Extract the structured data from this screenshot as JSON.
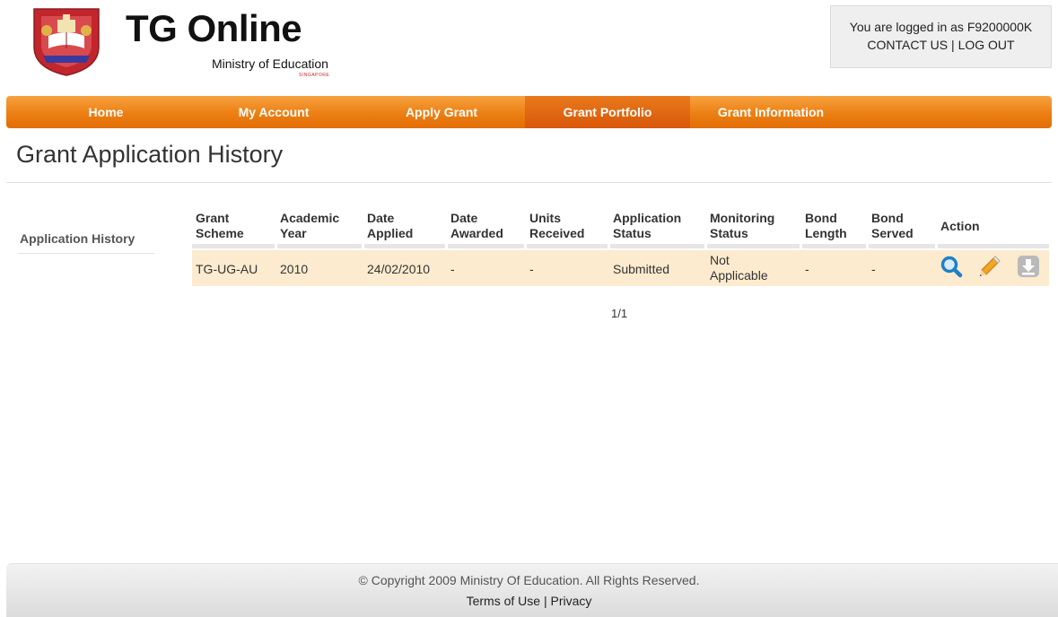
{
  "brand": {
    "title": "TG Online",
    "subtitle": "Ministry of Education",
    "country": "SINGAPORE",
    "crest_label": "SINGAPORE"
  },
  "session": {
    "logged_in_text": "You are logged in as F9200000K",
    "contact_label": "CONTACT US",
    "separator": "|",
    "logout_label": "LOG OUT"
  },
  "nav": {
    "items": [
      {
        "label": "Home"
      },
      {
        "label": "My Account"
      },
      {
        "label": "Apply Grant"
      },
      {
        "label": "Grant Portfolio",
        "active": true
      },
      {
        "label": "Grant Information"
      }
    ]
  },
  "page": {
    "title": "Grant Application History"
  },
  "sidebar": {
    "items": [
      {
        "label": "Application History"
      }
    ]
  },
  "table": {
    "headers": [
      {
        "line1": "Grant",
        "line2": "Scheme"
      },
      {
        "line1": "Academic",
        "line2": "Year"
      },
      {
        "line1": "Date",
        "line2": "Applied"
      },
      {
        "line1": "Date",
        "line2": "Awarded"
      },
      {
        "line1": "Units",
        "line2": "Received"
      },
      {
        "line1": "Application",
        "line2": "Status"
      },
      {
        "line1": "Monitoring",
        "line2": "Status"
      },
      {
        "line1": "Bond",
        "line2": "Length"
      },
      {
        "line1": "Bond",
        "line2": "Served"
      },
      {
        "line1": "Action",
        "line2": ""
      }
    ],
    "rows": [
      {
        "grant_scheme": "TG-UG-AU",
        "academic_year": "2010",
        "date_applied": "24/02/2010",
        "date_awarded": "-",
        "units_received": "-",
        "application_status": "Submitted",
        "monitoring_status_line1": "Not",
        "monitoring_status_line2": "Applicable",
        "bond_length": "-",
        "bond_served": "-",
        "actions": [
          "magnifier-icon",
          "pencil-icon",
          "download-icon"
        ]
      }
    ],
    "pager": "1/1"
  },
  "footer": {
    "copyright": "© Copyright 2009 Ministry Of Education. All Rights Reserved.",
    "terms_label": "Terms of Use",
    "separator": "|",
    "privacy_label": "Privacy"
  },
  "colors": {
    "nav_orange": "#ec7f13",
    "nav_active": "#d9580a",
    "row_highlight": "#fdebcf",
    "crest_red": "#c2262d"
  }
}
